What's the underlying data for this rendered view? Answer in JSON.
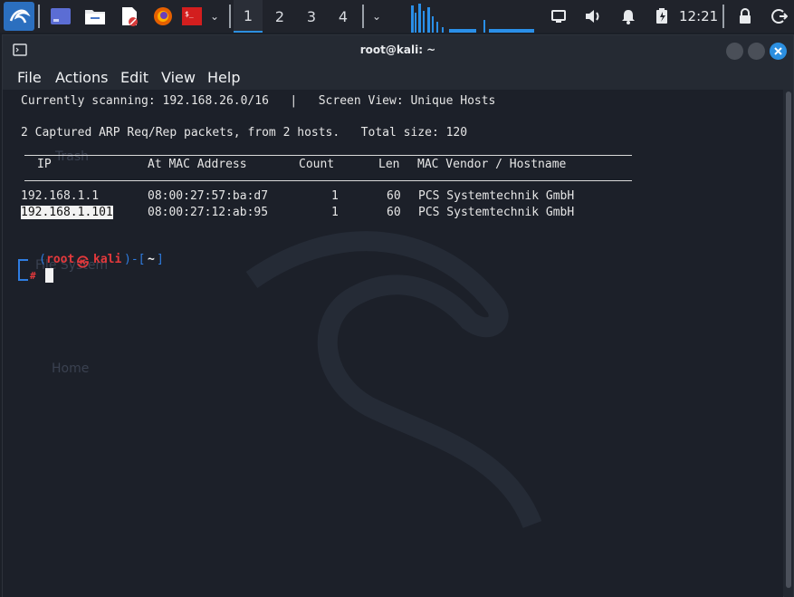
{
  "panel": {
    "workspaces": [
      "1",
      "2",
      "3",
      "4"
    ],
    "active_workspace": 0,
    "clock": "12:21"
  },
  "window": {
    "title": "root@kali: ~",
    "menu": [
      "File",
      "Actions",
      "Edit",
      "View",
      "Help"
    ]
  },
  "terminal": {
    "header_line": "Currently scanning: 192.168.26.0/16   |   Screen View: Unique Hosts",
    "summary_line": "2 Captured ARP Req/Rep packets, from 2 hosts.   Total size: 120",
    "columns": [
      "IP",
      "At MAC Address",
      "Count",
      "Len",
      "MAC Vendor / Hostname"
    ],
    "rows": [
      {
        "ip": "192.168.1.1",
        "mac": "08:00:27:57:ba:d7",
        "count": "1",
        "len": "60",
        "vendor": "PCS Systemtechnik GmbH"
      },
      {
        "ip": "192.168.1.101",
        "mac": "08:00:27:12:ab:95",
        "count": "1",
        "len": "60",
        "vendor": "PCS Systemtechnik GmbH"
      }
    ],
    "prompt": {
      "user": "root",
      "at": "㉿",
      "host": "kali",
      "dir": "~",
      "symbol": "#"
    }
  },
  "desktop": {
    "icons": [
      "Trash",
      "File System",
      "Home"
    ]
  },
  "colors": {
    "prompt_red": "#e4393c",
    "prompt_blue": "#2f7de1",
    "accent": "#2c8fe0"
  }
}
